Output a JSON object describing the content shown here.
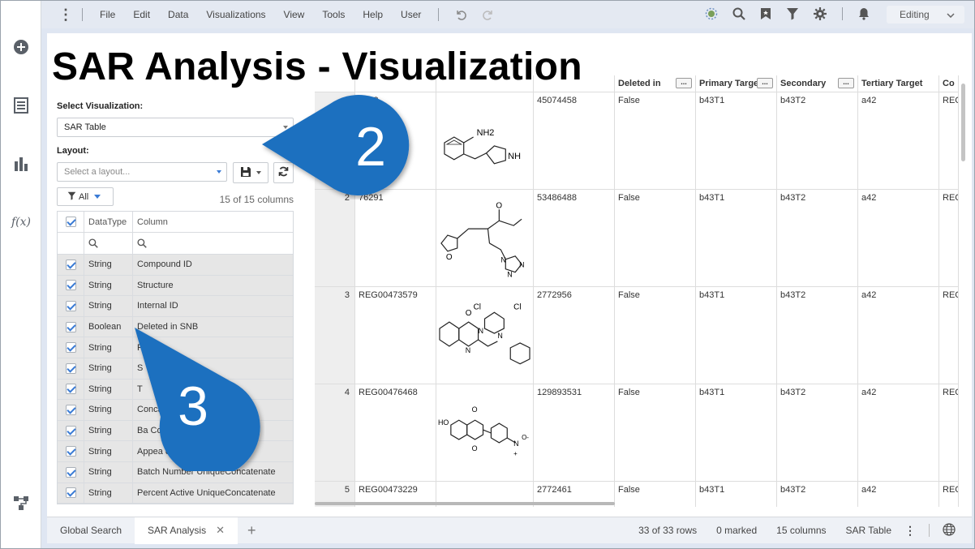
{
  "menu": {
    "items": [
      "File",
      "Edit",
      "Data",
      "Visualizations",
      "View",
      "Tools",
      "Help",
      "User"
    ],
    "mode": "Editing"
  },
  "rail": {
    "icons": [
      "add-icon",
      "data-table-icon",
      "bar-chart-icon",
      "fx-icon",
      "hierarchy-icon"
    ]
  },
  "title": "SAR Analysis - Visualization",
  "left_panel": {
    "select_visualization_label": "Select Visualization:",
    "selected_visualization": "SAR Table",
    "layout_label": "Layout:",
    "layout_placeholder": "Select a layout...",
    "filter_label": "All",
    "column_count": "15 of 15 columns",
    "headers": {
      "datatype": "DataType",
      "column": "Column"
    },
    "rows": [
      {
        "type": "String",
        "name": "Compound ID"
      },
      {
        "type": "String",
        "name": "Structure"
      },
      {
        "type": "String",
        "name": "Internal ID"
      },
      {
        "type": "Boolean",
        "name": "Deleted in SNB"
      },
      {
        "type": "String",
        "name": "Focus"
      },
      {
        "type": "String",
        "name": "S"
      },
      {
        "type": "String",
        "name": "T"
      },
      {
        "type": "String",
        "name": "Concatenate"
      },
      {
        "type": "String",
        "name": "Ba                    Concatenate"
      },
      {
        "type": "String",
        "name": "Appea               concatenate"
      },
      {
        "type": "String",
        "name": "Batch Number UniqueConcatenate"
      },
      {
        "type": "String",
        "name": "Percent Active UniqueConcatenate"
      }
    ]
  },
  "grid": {
    "headers": [
      "",
      "",
      "",
      "",
      "Deleted in",
      "Primary Targe",
      "Secondary",
      "Tertiary Target",
      "Co"
    ],
    "rows": [
      {
        "num": "",
        "id": "4553",
        "internal": "45074458",
        "deleted": "False",
        "primary": "b43T1",
        "secondary": "b43T2",
        "tertiary": "a42",
        "co": "REC"
      },
      {
        "num": "2",
        "id": "76291",
        "internal": "53486488",
        "deleted": "False",
        "primary": "b43T1",
        "secondary": "b43T2",
        "tertiary": "a42",
        "co": "REC"
      },
      {
        "num": "3",
        "id": "REG00473579",
        "internal": "2772956",
        "deleted": "False",
        "primary": "b43T1",
        "secondary": "b43T2",
        "tertiary": "a42",
        "co": "REC"
      },
      {
        "num": "4",
        "id": "REG00476468",
        "internal": "129893531",
        "deleted": "False",
        "primary": "b43T1",
        "secondary": "b43T2",
        "tertiary": "a42",
        "co": "REC"
      },
      {
        "num": "5",
        "id": "REG00473229",
        "internal": "2772461",
        "deleted": "False",
        "primary": "b43T1",
        "secondary": "b43T2",
        "tertiary": "a42",
        "co": "REC"
      }
    ],
    "structure_labels": {
      "r1": [
        "NH2",
        "NH"
      ],
      "r2": [
        "O",
        "O",
        "N",
        "N",
        "N"
      ],
      "r3": [
        "Cl",
        "Cl",
        "O",
        "N",
        "N",
        "N"
      ],
      "r4": [
        "O",
        "HO",
        "O",
        "N",
        "O-",
        "+"
      ]
    }
  },
  "bottom": {
    "tabs": [
      {
        "label": "Global Search"
      },
      {
        "label": "SAR Analysis"
      }
    ],
    "rows_count": "33 of 33 rows",
    "marked": "0 marked",
    "columns": "15 columns",
    "view": "SAR Table"
  },
  "callouts": [
    "2",
    "3"
  ],
  "colors": {
    "accent": "#3a7bd5",
    "callout": "#1f6fbf",
    "chrome": "#e4e9f2"
  }
}
